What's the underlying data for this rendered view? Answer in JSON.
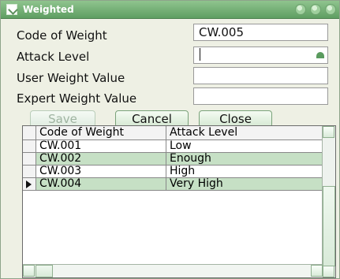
{
  "window": {
    "title": "Weighted",
    "controls": [
      "min",
      "max",
      "close"
    ]
  },
  "form": {
    "code_of_weight_label": "Code of Weight",
    "code_of_weight_value": "CW.005",
    "attack_level_label": "Attack Level",
    "user_weight_value_label": "User Weight Value",
    "expert_weight_value_label": "Expert Weight Value"
  },
  "buttons": {
    "save": "Save",
    "cancel": "Cancel",
    "close": "Close"
  },
  "grid": {
    "columns": [
      "Code of Weight",
      "Attack Level"
    ],
    "rows": [
      [
        "CW.001",
        "Low"
      ],
      [
        "CW.002",
        "Enough"
      ],
      [
        "CW.003",
        "High"
      ],
      [
        "CW.004",
        "Very High"
      ]
    ],
    "selected_row_index": 3
  },
  "colors": {
    "title_green": "#5f9e62",
    "row_highlight": "#c6e0c5",
    "window_bg": "#eef0e4"
  }
}
